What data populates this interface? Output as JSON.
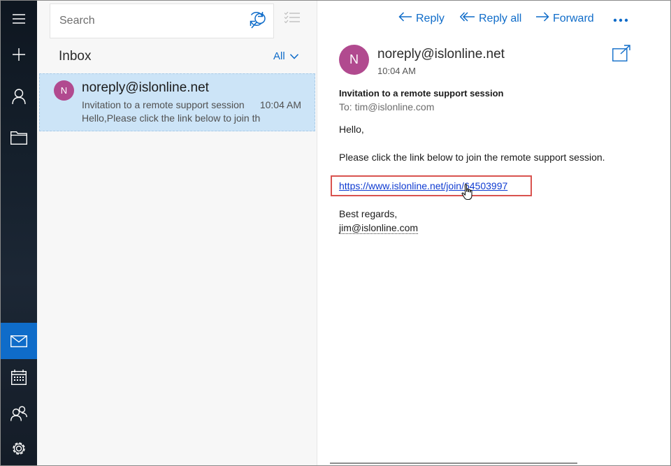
{
  "nav_rail": {
    "items": [
      "menu-icon",
      "plus-icon",
      "person-icon",
      "folder-icon",
      "mail-icon",
      "calendar-icon",
      "people-icon",
      "gear-icon"
    ],
    "active_item": "mail-icon",
    "accent": "#0f6cc9"
  },
  "list_pane": {
    "search_placeholder": "Search",
    "folder_title": "Inbox",
    "filter_label": "All",
    "messages": [
      {
        "avatar_initial": "N",
        "from": "noreply@islonline.net",
        "subject": "Invitation to a remote support session",
        "time": "10:04 AM",
        "preview": "Hello,Please click the link below to join the",
        "selected": true
      }
    ]
  },
  "reading_pane": {
    "toolbar": {
      "reply_label": "Reply",
      "reply_all_label": "Reply all",
      "forward_label": "Forward",
      "more_icon": "more-dots-icon"
    },
    "sender": {
      "avatar_initial": "N",
      "address": "noreply@islonline.net",
      "time": "10:04 AM"
    },
    "subject": "Invitation to a remote support session",
    "to_line": "To: tim@islonline.com",
    "body": {
      "greeting": "Hello,",
      "line1": "Please click the link below to join the remote support session.",
      "link": "https://www.islonline.net/join/64503997",
      "closing": "Best regards,",
      "signature": "jim@islonline.com"
    }
  },
  "colors": {
    "selected_row": "#cce4f7",
    "avatar": "#b14a8f",
    "highlight_box": "#d9534f"
  }
}
